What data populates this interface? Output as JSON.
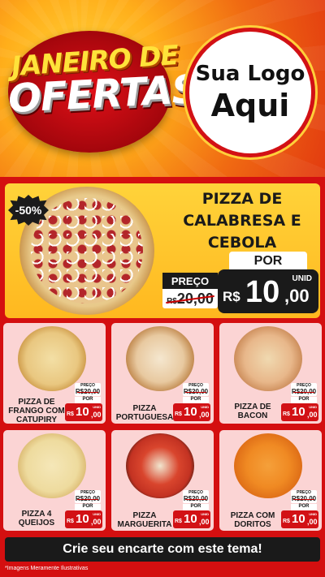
{
  "header": {
    "title_line1": "JANEIRO DE",
    "title_line2": "OFERTAS",
    "logo_line1": "Sua Logo",
    "logo_line2": "Aqui"
  },
  "featured": {
    "discount": "-50%",
    "name_line1": "PIZZA DE",
    "name_line2": "CALABRESA E",
    "name_line3": "CEBOLA",
    "preco_label": "PREÇO",
    "old_currency": "R$",
    "old_price": "20,00",
    "por_label": "POR",
    "currency": "R$",
    "price_int": "10",
    "price_cents": ",00",
    "unit": "UNID"
  },
  "products": [
    {
      "name": "PIZZA DE FRANGO COM CATUPIRY",
      "preco_label": "PREÇO",
      "old_price": "R$20,00",
      "por_label": "POR",
      "currency": "R$",
      "price_int": "10",
      "price_cents": ",00",
      "unit": "UNID"
    },
    {
      "name": "PIZZA PORTUGUESA",
      "preco_label": "PREÇO",
      "old_price": "R$20,00",
      "por_label": "POR",
      "currency": "R$",
      "price_int": "10",
      "price_cents": ",00",
      "unit": "UNID"
    },
    {
      "name": "PIZZA DE BACON",
      "preco_label": "PREÇO",
      "old_price": "R$20,00",
      "por_label": "POR",
      "currency": "R$",
      "price_int": "10",
      "price_cents": ",00",
      "unit": "UNID"
    },
    {
      "name": "PIZZA 4 QUEIJOS",
      "preco_label": "PREÇO",
      "old_price": "R$20,00",
      "por_label": "POR",
      "currency": "R$",
      "price_int": "10",
      "price_cents": ",00",
      "unit": "UNID"
    },
    {
      "name": "PIZZA MARGUERITA",
      "preco_label": "PREÇO",
      "old_price": "R$20,00",
      "por_label": "POR",
      "currency": "R$",
      "price_int": "10",
      "price_cents": ",00",
      "unit": "UNID"
    },
    {
      "name": "PIZZA COM DORITOS",
      "preco_label": "PREÇO",
      "old_price": "R$20,00",
      "por_label": "POR",
      "currency": "R$",
      "price_int": "10",
      "price_cents": ",00",
      "unit": "UNID"
    }
  ],
  "cta": "Crie seu encarte com este tema!",
  "footnote": "*Imagens Meramente Ilustrativas",
  "colors": {
    "brand_red": "#d21115",
    "accent_yellow": "#ffc62a",
    "card_pink": "#fbd4d4",
    "dark": "#1a1a1a"
  }
}
